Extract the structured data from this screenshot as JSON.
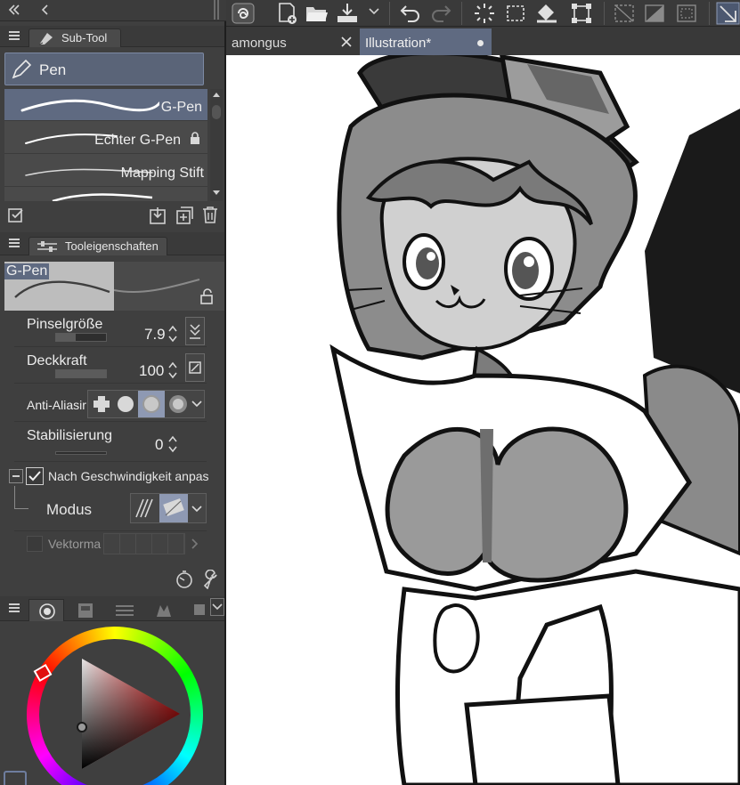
{
  "subtool_panel": {
    "tab_label": "Sub-Tool",
    "group_label": "Pen",
    "brushes": [
      {
        "name": "G-Pen",
        "selected": true
      },
      {
        "name": "Echter G-Pen",
        "locked": true
      },
      {
        "name": "Mapping Stift"
      },
      {
        "name": "..."
      }
    ]
  },
  "tool_properties": {
    "tab_label": "Tooleigenschaften",
    "preview_name": "G-Pen",
    "brush_size": {
      "label": "Pinselgröße",
      "value": "7.9"
    },
    "opacity": {
      "label": "Deckkraft",
      "value": "100"
    },
    "anti_aliasing": {
      "label": "Anti-Aliasir",
      "selected_index": 2
    },
    "stabilization": {
      "label": "Stabilisierung",
      "value": "0"
    },
    "speed_adjust": {
      "label": "Nach Geschwindigkeit anpas",
      "checked": true
    },
    "mode": {
      "label": "Modus",
      "selected_index": 1
    },
    "vector": {
      "label": "Vektorma"
    }
  },
  "documents": {
    "tabs": [
      {
        "name": "amongus",
        "active": false
      },
      {
        "name": "Illustration*",
        "active": true
      }
    ]
  },
  "color_wheel": {
    "hue_color": "#e01010"
  },
  "colors": {
    "accent": "#5f6a81",
    "selected_tab": "#5a6478"
  }
}
